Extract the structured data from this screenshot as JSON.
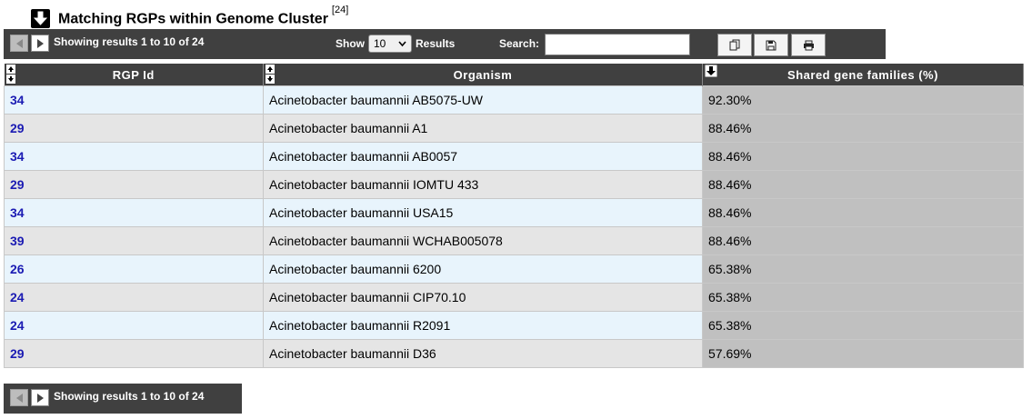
{
  "title": {
    "text": "Matching RGPs within Genome Cluster",
    "count": "[24]"
  },
  "toolbar": {
    "showing": "Showing results 1 to 10 of 24",
    "show_label": "Show",
    "show_value": "10",
    "results_label": "Results",
    "search_label": "Search:",
    "search_value": ""
  },
  "table": {
    "headers": [
      "RGP Id",
      "Organism",
      "Shared gene families (%)"
    ],
    "rows": [
      {
        "rgp": "34",
        "organism": "Acinetobacter baumannii AB5075-UW",
        "shared": "92.30%"
      },
      {
        "rgp": "29",
        "organism": "Acinetobacter baumannii A1",
        "shared": "88.46%"
      },
      {
        "rgp": "34",
        "organism": "Acinetobacter baumannii AB0057",
        "shared": "88.46%"
      },
      {
        "rgp": "29",
        "organism": "Acinetobacter baumannii IOMTU 433",
        "shared": "88.46%"
      },
      {
        "rgp": "34",
        "organism": "Acinetobacter baumannii USA15",
        "shared": "88.46%"
      },
      {
        "rgp": "39",
        "organism": "Acinetobacter baumannii WCHAB005078",
        "shared": "88.46%"
      },
      {
        "rgp": "26",
        "organism": "Acinetobacter baumannii 6200",
        "shared": "65.38%"
      },
      {
        "rgp": "24",
        "organism": "Acinetobacter baumannii CIP70.10",
        "shared": "65.38%"
      },
      {
        "rgp": "24",
        "organism": "Acinetobacter baumannii R2091",
        "shared": "65.38%"
      },
      {
        "rgp": "29",
        "organism": "Acinetobacter baumannii D36",
        "shared": "57.69%"
      }
    ]
  },
  "footer": {
    "showing": "Showing results 1 to 10 of 24"
  }
}
